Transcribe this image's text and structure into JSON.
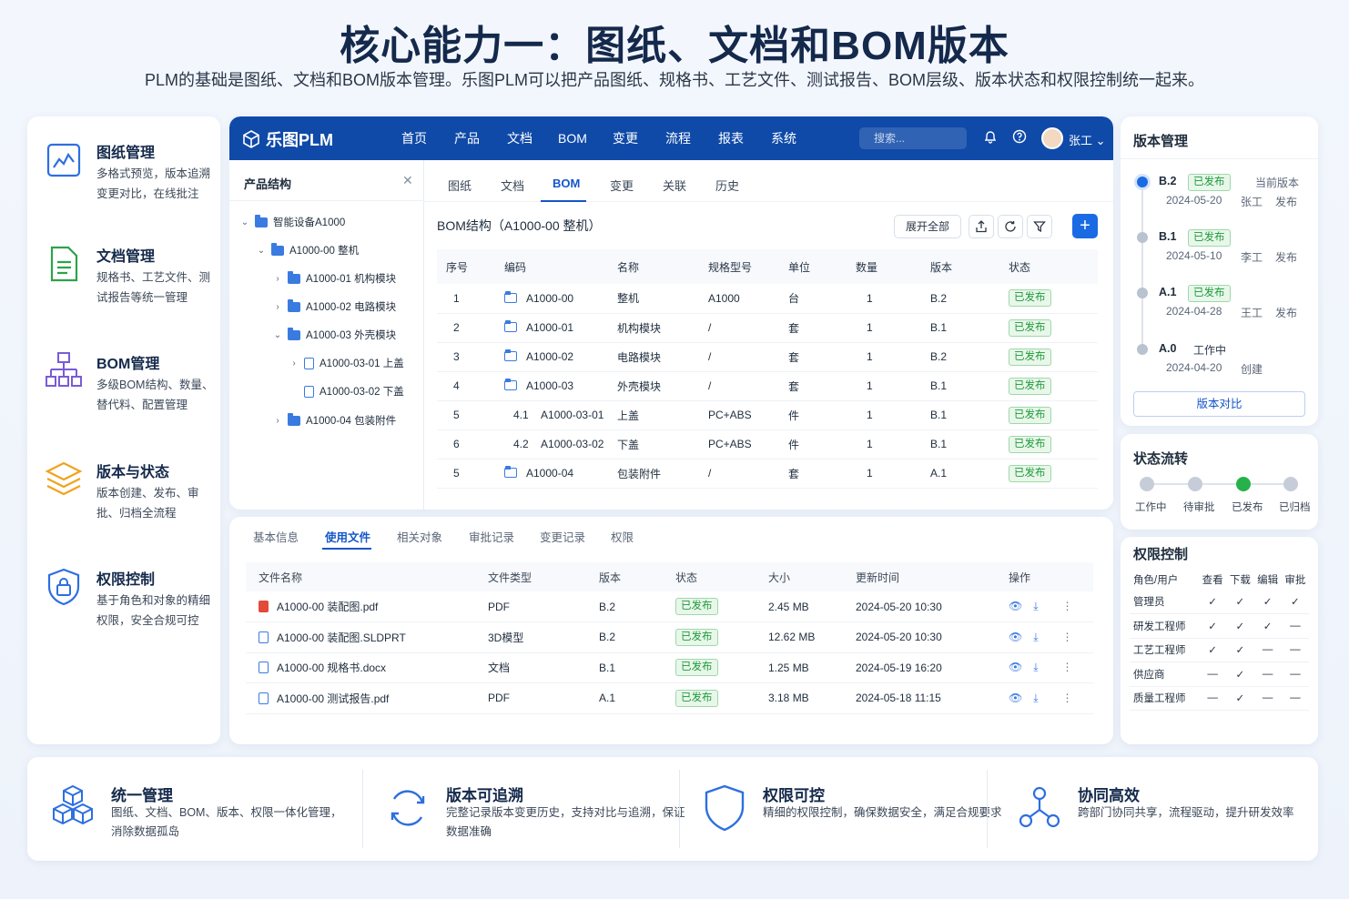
{
  "header": {
    "title": "核心能力一：图纸、文档和BOM版本",
    "subtitle": "PLM的基础是图纸、文档和BOM版本管理。乐图PLM可以把产品图纸、规格书、工艺文件、测试报告、BOM层级、版本状态和权限控制统一起来。"
  },
  "features": [
    {
      "title": "图纸管理",
      "desc": "多格式预览，版本追溯变更对比，在线批注",
      "icon": "drawing-icon"
    },
    {
      "title": "文档管理",
      "desc": "规格书、工艺文件、测试报告等统一管理",
      "icon": "document-icon"
    },
    {
      "title": "BOM管理",
      "desc": "多级BOM结构、数量、替代料、配置管理",
      "icon": "bom-tree-icon"
    },
    {
      "title": "版本与状态",
      "desc": "版本创建、发布、审批、归档全流程",
      "icon": "layers-icon"
    },
    {
      "title": "权限控制",
      "desc": "基于角色和对象的精细权限，安全合规可控",
      "icon": "lock-shield-icon"
    }
  ],
  "app": {
    "logo": "乐图PLM",
    "nav": [
      "首页",
      "产品",
      "文档",
      "BOM",
      "变更",
      "流程",
      "报表",
      "系统"
    ],
    "search_placeholder": "搜索...",
    "user": "张工",
    "tree": {
      "title": "产品结构",
      "nodes": [
        {
          "label": "智能设备A1000",
          "arrow": "⌄"
        },
        {
          "label": "A1000-00 整机",
          "arrow": "⌄"
        },
        {
          "label": "A1000-01 机构模块",
          "arrow": "›"
        },
        {
          "label": "A1000-02 电路模块",
          "arrow": "›"
        },
        {
          "label": "A1000-03 外壳模块",
          "arrow": "⌄"
        },
        {
          "label": "A1000-03-01 上盖",
          "arrow": "›"
        },
        {
          "label": "A1000-03-02 下盖",
          "arrow": ""
        },
        {
          "label": "A1000-04 包装附件",
          "arrow": "›"
        }
      ]
    },
    "tabs": [
      "图纸",
      "文档",
      "BOM",
      "变更",
      "关联",
      "历史"
    ],
    "bom_title": "BOM结构（A1000-00 整机）",
    "expand_all": "展开全部",
    "bom_headers": [
      "序号",
      "编码",
      "名称",
      "规格型号",
      "单位",
      "数量",
      "版本",
      "状态"
    ],
    "bom_rows": [
      {
        "seq": "1",
        "sub": "",
        "code": "A1000-00",
        "name": "整机",
        "spec": "A1000",
        "unit": "台",
        "qty": "1",
        "ver": "B.2",
        "status": "已发布"
      },
      {
        "seq": "2",
        "sub": "",
        "code": "A1000-01",
        "name": "机构模块",
        "spec": "/",
        "unit": "套",
        "qty": "1",
        "ver": "B.1",
        "status": "已发布"
      },
      {
        "seq": "3",
        "sub": "",
        "code": "A1000-02",
        "name": "电路模块",
        "spec": "/",
        "unit": "套",
        "qty": "1",
        "ver": "B.2",
        "status": "已发布"
      },
      {
        "seq": "4",
        "sub": "",
        "code": "A1000-03",
        "name": "外壳模块",
        "spec": "/",
        "unit": "套",
        "qty": "1",
        "ver": "B.1",
        "status": "已发布"
      },
      {
        "seq": "5",
        "sub": "4.1",
        "code": "A1000-03-01",
        "name": "上盖",
        "spec": "PC+ABS",
        "unit": "件",
        "qty": "1",
        "ver": "B.1",
        "status": "已发布"
      },
      {
        "seq": "6",
        "sub": "4.2",
        "code": "A1000-03-02",
        "name": "下盖",
        "spec": "PC+ABS",
        "unit": "件",
        "qty": "1",
        "ver": "B.1",
        "status": "已发布"
      },
      {
        "seq": "5",
        "sub": "",
        "code": "A1000-04",
        "name": "包装附件",
        "spec": "/",
        "unit": "套",
        "qty": "1",
        "ver": "A.1",
        "status": "已发布"
      }
    ]
  },
  "files": {
    "tabs": [
      "基本信息",
      "使用文件",
      "相关对象",
      "审批记录",
      "变更记录",
      "权限"
    ],
    "headers": [
      "文件名称",
      "文件类型",
      "版本",
      "状态",
      "大小",
      "更新时间",
      "操作"
    ],
    "rows": [
      {
        "name": "A1000-00 装配图.pdf",
        "type": "PDF",
        "ver": "B.2",
        "status": "已发布",
        "size": "2.45 MB",
        "time": "2024-05-20 10:30",
        "icon": "pdf"
      },
      {
        "name": "A1000-00 装配图.SLDPRT",
        "type": "3D模型",
        "ver": "B.2",
        "status": "已发布",
        "size": "12.62 MB",
        "time": "2024-05-20 10:30",
        "icon": "doc"
      },
      {
        "name": "A1000-00 规格书.docx",
        "type": "文档",
        "ver": "B.1",
        "status": "已发布",
        "size": "1.25 MB",
        "time": "2024-05-19 16:20",
        "icon": "doc"
      },
      {
        "name": "A1000-00 测试报告.pdf",
        "type": "PDF",
        "ver": "A.1",
        "status": "已发布",
        "size": "3.18 MB",
        "time": "2024-05-18 11:15",
        "icon": "doc"
      }
    ]
  },
  "versions": {
    "title": "版本管理",
    "items": [
      {
        "ver": "B.2",
        "status": "已发布",
        "note": "当前版本",
        "date": "2024-05-20",
        "user": "张工",
        "action": "发布",
        "current": true
      },
      {
        "ver": "B.1",
        "status": "已发布",
        "note": "",
        "date": "2024-05-10",
        "user": "李工",
        "action": "发布",
        "current": false
      },
      {
        "ver": "A.1",
        "status": "已发布",
        "note": "",
        "date": "2024-04-28",
        "user": "王工",
        "action": "发布",
        "current": false
      },
      {
        "ver": "A.0",
        "status": "工作中",
        "note": "",
        "date": "2024-04-20",
        "user": "",
        "action": "创建",
        "current": false
      }
    ],
    "compare": "版本对比"
  },
  "flow": {
    "title": "状态流转",
    "steps": [
      "工作中",
      "待审批",
      "已发布",
      "已归档"
    ],
    "active_index": 2
  },
  "perm": {
    "title": "权限控制",
    "headers": [
      "角色/用户",
      "查看",
      "下载",
      "编辑",
      "审批"
    ],
    "rows": [
      {
        "role": "管理员",
        "v": [
          "✓",
          "✓",
          "✓",
          "✓"
        ]
      },
      {
        "role": "研发工程师",
        "v": [
          "✓",
          "✓",
          "✓",
          "—"
        ]
      },
      {
        "role": "工艺工程师",
        "v": [
          "✓",
          "✓",
          "—",
          "—"
        ]
      },
      {
        "role": "供应商",
        "v": [
          "—",
          "✓",
          "—",
          "—"
        ]
      },
      {
        "role": "质量工程师",
        "v": [
          "—",
          "✓",
          "—",
          "—"
        ]
      }
    ]
  },
  "strip": [
    {
      "title": "统一管理",
      "desc": "图纸、文档、BOM、版本、权限一体化管理，消除数据孤岛",
      "icon": "cubes-icon"
    },
    {
      "title": "版本可追溯",
      "desc": "完整记录版本变更历史，支持对比与追溯，保证数据准确",
      "icon": "refresh-icon"
    },
    {
      "title": "权限可控",
      "desc": "精细的权限控制，确保数据安全，满足合规要求",
      "icon": "shield-icon"
    },
    {
      "title": "协同高效",
      "desc": "跨部门协同共享，流程驱动，提升研发效率",
      "icon": "network-icon"
    }
  ]
}
